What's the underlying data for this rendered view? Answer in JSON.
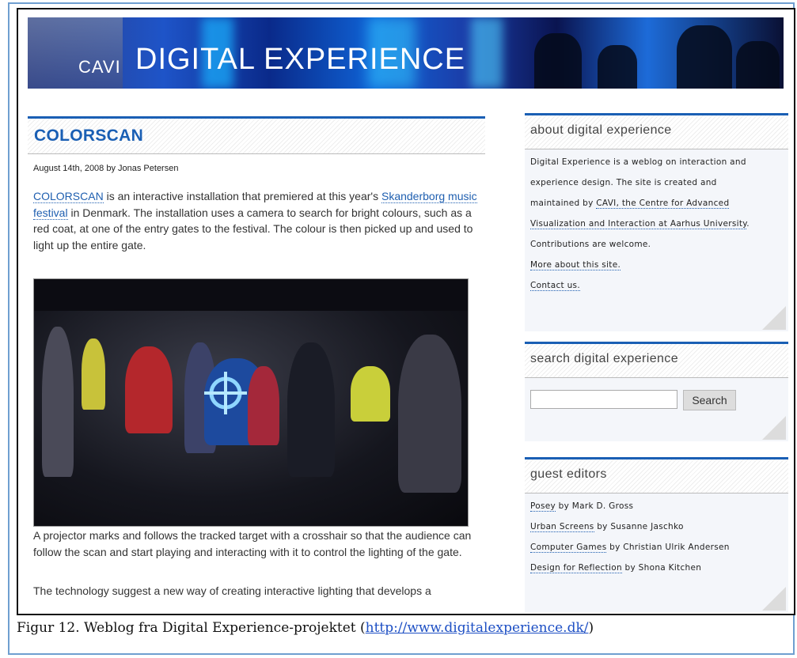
{
  "banner": {
    "small": "CAVI",
    "big": "DIGITAL EXPERIENCE"
  },
  "post": {
    "title": "COLORSCAN",
    "meta": "August 14th, 2008 by Jonas Petersen",
    "p1_link1": "COLORSCAN",
    "p1_text1": " is an interactive installation that premiered at this year's ",
    "p1_link2": "Skanderborg music festival",
    "p1_text2": " in Denmark. The installation uses a camera to search for bright colours, such as a red coat, at one of the entry gates to the festival. The colour is then picked up and used to light up the entire gate.",
    "p2": "A projector marks and follows the tracked target with a crosshair so that the audience can follow the scan and start playing and interacting with it to control the lighting of the gate.",
    "p3": "The technology suggest a new way of creating interactive lighting that develops a"
  },
  "sidebar": {
    "about": {
      "title": "about digital experience",
      "line1": "Digital Experience is a weblog on interaction and",
      "line2": "experience design. The site is created and",
      "line3_text": "maintained by ",
      "line3_link": "CAVI, the Centre for Advanced",
      "line4_link": "Visualization and Interaction at Aarhus University",
      "line4_text": ".",
      "line5": "Contributions are welcome.",
      "more_link": "More about this site.",
      "contact_link": "Contact us."
    },
    "search": {
      "title": "search digital experience",
      "button": "Search",
      "value": ""
    },
    "guests": {
      "title": "guest editors",
      "items": [
        {
          "link": "Posey",
          "by": " by Mark D. Gross"
        },
        {
          "link": "Urban Screens",
          "by": " by Susanne Jaschko"
        },
        {
          "link": "Computer Games",
          "by": " by Christian Ulrik Andersen"
        },
        {
          "link": "Design for Reflection",
          "by": " by Shona Kitchen"
        }
      ]
    }
  },
  "caption": {
    "text": "Figur 12. Weblog fra Digital Experience-projektet (",
    "link": "http://www.digitalexperience.dk/",
    "end": ")"
  },
  "colors": {
    "accent": "#1a5fb4",
    "link": "#1f5fb0",
    "frame": "#6f9fd0"
  }
}
